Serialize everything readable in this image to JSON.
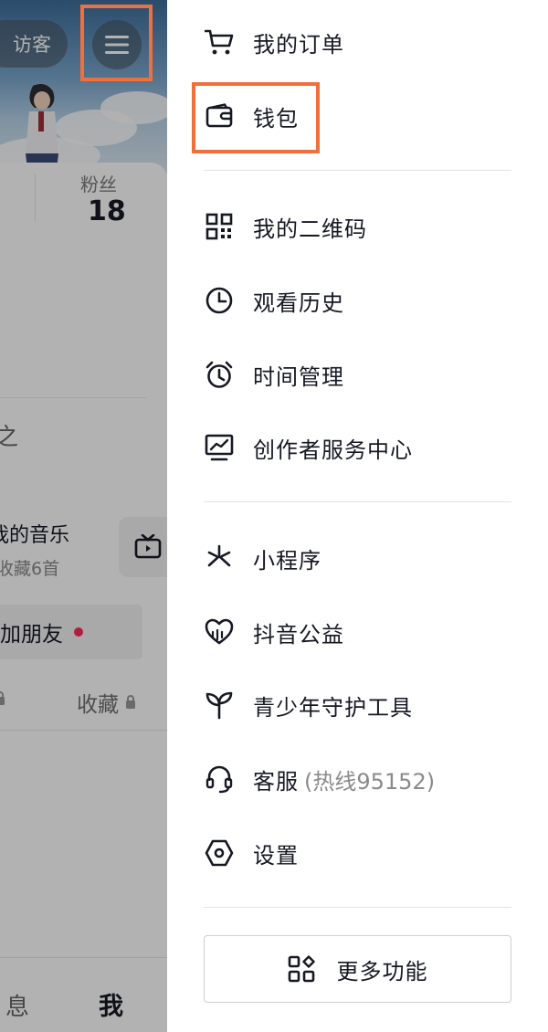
{
  "profile": {
    "visitor_label": "访客",
    "fans_label": "粉丝",
    "fans_count": "18",
    "partial_text": "之",
    "music_title": "我的音乐",
    "music_sub": "收藏6首",
    "add_friend": "加朋友",
    "collect_tab": "收藏",
    "nav_message": "息",
    "nav_me": "我"
  },
  "drawer": {
    "items": [
      {
        "label": "我的订单",
        "icon": "cart-icon"
      },
      {
        "label": "钱包",
        "icon": "wallet-icon"
      },
      {
        "label": "我的二维码",
        "icon": "qrcode-icon"
      },
      {
        "label": "观看历史",
        "icon": "clock-icon"
      },
      {
        "label": "时间管理",
        "icon": "alarm-icon"
      },
      {
        "label": "创作者服务中心",
        "icon": "chart-monitor-icon"
      },
      {
        "label": "小程序",
        "icon": "mini-program-icon"
      },
      {
        "label": "抖音公益",
        "icon": "charity-heart-icon"
      },
      {
        "label": "青少年守护工具",
        "icon": "sprout-icon"
      },
      {
        "label": "客服",
        "note": "(热线95152)",
        "icon": "headset-icon"
      },
      {
        "label": "设置",
        "icon": "settings-hex-icon"
      }
    ],
    "more_button": "更多功能"
  },
  "colors": {
    "highlight": "#f0703c",
    "text": "#161823",
    "accent_dot": "#fe2c55"
  }
}
